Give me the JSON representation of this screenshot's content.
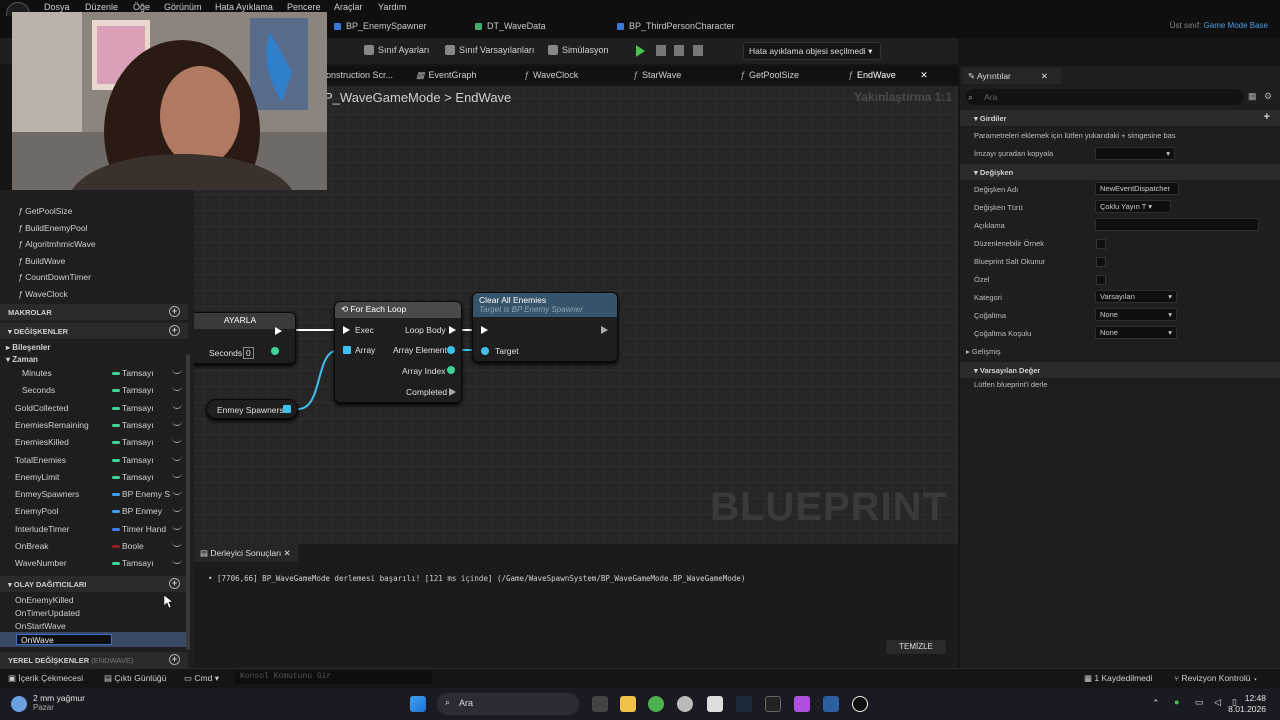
{
  "menu": [
    "Dosya",
    "Düzenle",
    "Öğe",
    "Görünüm",
    "Hata Ayıklama",
    "Pencere",
    "Araçlar",
    "Yardım"
  ],
  "doc_tabs": [
    "BP_EnemySpawner",
    "DT_WaveData",
    "BP_ThirdPersonCharacter"
  ],
  "parent_class": {
    "label": "Üst sınıf:",
    "value": "Game Mode Base"
  },
  "toolbar": {
    "class_settings": "Sınıf Ayarları",
    "class_defaults": "Sınıf Varsayılanları",
    "simulation": "Simülasyon",
    "debug_object": "Hata ayıklama objesi seçilmedi"
  },
  "graph_tabs": [
    "onstruction Scr...",
    "EventGraph",
    "WaveClock",
    "StarWave",
    "GetPoolSize",
    "EndWave"
  ],
  "breadcrumb": {
    "parent": "P_WaveGameMode",
    "current": "EndWave"
  },
  "zoom": "Yakınlaştırma 1:1",
  "watermark": "BLUEPRINT",
  "nodes": {
    "set": {
      "title": "AYARLA",
      "pin_seconds": "Seconds",
      "seconds_value": "0"
    },
    "foreach": {
      "title": "For Each Loop",
      "exec": "Exec",
      "loop_body": "Loop Body",
      "array": "Array",
      "array_element": "Array Element",
      "array_index": "Array Index",
      "completed": "Completed"
    },
    "clear": {
      "title": "Clear All Enemies",
      "subtitle": "Target is BP Enemy Spawner",
      "target": "Target"
    },
    "getter": {
      "label": "Enmey Spawners"
    }
  },
  "functions": [
    "GetPoolSize",
    "BuildEnemyPool",
    "AlgoritmhmicWave",
    "BuildWave",
    "CountDownTimer",
    "WaveClock"
  ],
  "sections": {
    "macros": "MAKROLAR",
    "variables": "DEĞİŞKENLER",
    "dispatchers": "OLAY DAĞITICILARI",
    "locals": "YEREL DEĞİŞKENLER",
    "locals_sub": "(ENDWAVE)"
  },
  "categories": {
    "components": "Bileşenler",
    "time": "Zaman"
  },
  "variables": [
    {
      "name": "Minutes",
      "type": "Tamsayı",
      "color": "#3fd39a",
      "indent": true
    },
    {
      "name": "Seconds",
      "type": "Tamsayı",
      "color": "#3fd39a",
      "indent": true
    },
    {
      "name": "GoldCollected",
      "type": "Tamsayı",
      "color": "#3fd39a",
      "indent": false
    },
    {
      "name": "EnemiesRemaining",
      "type": "Tamsayı",
      "color": "#3fd39a",
      "indent": false
    },
    {
      "name": "EnemiesKilled",
      "type": "Tamsayı",
      "color": "#3fd39a",
      "indent": false
    },
    {
      "name": "TotalEnemies",
      "type": "Tamsayı",
      "color": "#3fd39a",
      "indent": false
    },
    {
      "name": "EnemyLimit",
      "type": "Tamsayı",
      "color": "#3fd39a",
      "indent": false
    },
    {
      "name": "EnmeySpawners",
      "type": "BP Enemy S",
      "color": "#3fa0f0",
      "indent": false
    },
    {
      "name": "EnemyPool",
      "type": "BP Enmey",
      "color": "#3fa0f0",
      "indent": false
    },
    {
      "name": "InterludeTimer",
      "type": "Timer Hand",
      "color": "#3f7ef0",
      "indent": false
    },
    {
      "name": "OnBreak",
      "type": "Boole",
      "color": "#9a1c1c",
      "indent": false
    },
    {
      "name": "WaveNumber",
      "type": "Tamsayı",
      "color": "#3fd39a",
      "indent": false
    }
  ],
  "dispatchers": [
    "OnEnemyKilled",
    "OnTimerUpdated",
    "OnStartWave"
  ],
  "dispatcher_editing": "OnWave",
  "compiler": {
    "tab": "Derleyici Sonuçları",
    "message": "[7706,66] BP_WaveGameMode derlemesi başarılı! [121 ms içinde] (/Game/WaveSpawnSystem/BP_WaveGameMode.BP_WaveGameMode)",
    "clear": "TEMİZLE"
  },
  "details": {
    "tab": "Ayrıntılar",
    "search_placeholder": "Ara",
    "inputs_header": "Girdiler",
    "inputs_hint": "Parametreleri eklemek için lütfen yukarıdaki + simgesine bas",
    "copy_signature": "İmzayı şuradan kopyala",
    "variable_header": "Değişken",
    "var_name_label": "Değişken Adı",
    "var_name_value": "NewEventDispatcher",
    "var_type_label": "Değişken Türü",
    "var_type_value": "Çoklu Yayın T",
    "description_label": "Açıklama",
    "editable_label": "Düzenlenebilir Örnek",
    "bp_readonly_label": "Blueprint Salt Okunur",
    "private_label": "Özel",
    "category_label": "Kategori",
    "category_value": "Varsayılan",
    "replication_label": "Çoğaltma",
    "replication_value": "None",
    "rep_condition_label": "Çoğaltma Koşulu",
    "rep_condition_value": "None",
    "advanced": "Gelişmiş",
    "default_header": "Varsayılan Değer",
    "default_hint": "Lütfen blueprint'i derle"
  },
  "statusbar": {
    "content": "İçerik Çekmecesi",
    "output": "Çıktı Günlüğü",
    "cmd": "Cmd",
    "cmd_placeholder": "Konsol Komutunu Gir",
    "saved": "1 Kaydedilmedi",
    "revision": "Revizyon Kontrolü"
  },
  "taskbar": {
    "weather_temp": "2 mm yağmur",
    "weather_day": "Pazar",
    "search": "Ara",
    "time": "12:48",
    "date": "8.01.2026"
  }
}
